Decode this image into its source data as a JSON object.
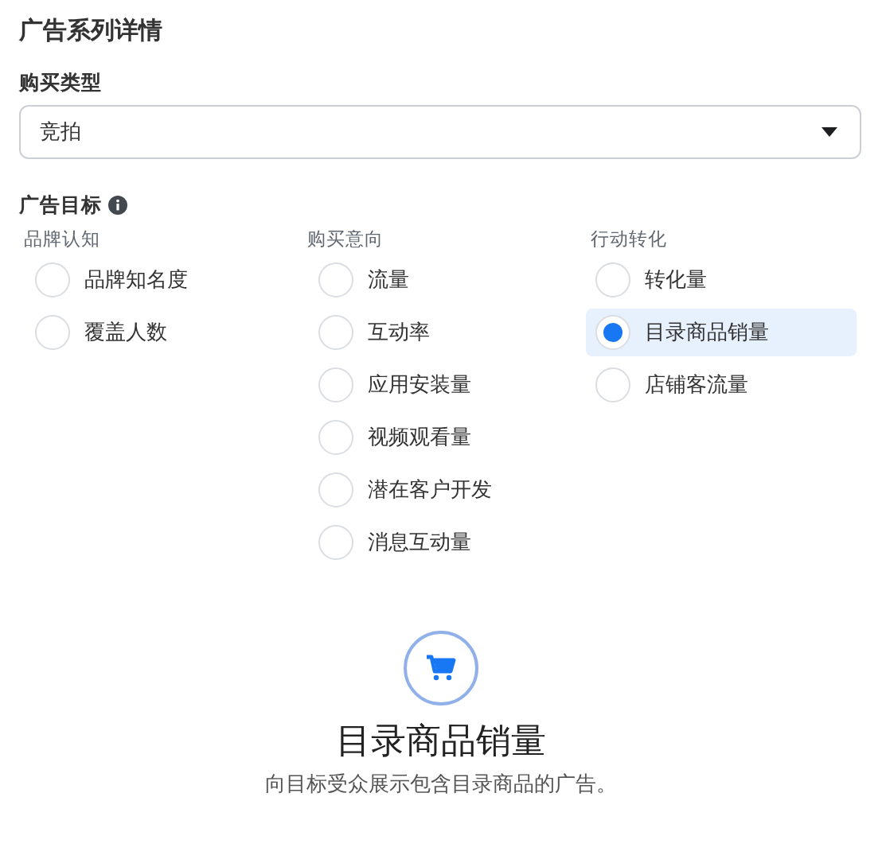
{
  "section_title": "广告系列详情",
  "buying_type": {
    "label": "购买类型",
    "value": "竞拍"
  },
  "objective": {
    "label": "广告目标",
    "groups": [
      {
        "heading": "品牌认知",
        "options": [
          {
            "label": "品牌知名度",
            "selected": false
          },
          {
            "label": "覆盖人数",
            "selected": false
          }
        ]
      },
      {
        "heading": "购买意向",
        "options": [
          {
            "label": "流量",
            "selected": false
          },
          {
            "label": "互动率",
            "selected": false
          },
          {
            "label": "应用安装量",
            "selected": false
          },
          {
            "label": "视频观看量",
            "selected": false
          },
          {
            "label": "潜在客户开发",
            "selected": false
          },
          {
            "label": "消息互动量",
            "selected": false
          }
        ]
      },
      {
        "heading": "行动转化",
        "options": [
          {
            "label": "转化量",
            "selected": false
          },
          {
            "label": "目录商品销量",
            "selected": true
          },
          {
            "label": "店铺客流量",
            "selected": false
          }
        ]
      }
    ]
  },
  "summary": {
    "title": "目录商品销量",
    "description": "向目标受众展示包含目录商品的广告。"
  }
}
